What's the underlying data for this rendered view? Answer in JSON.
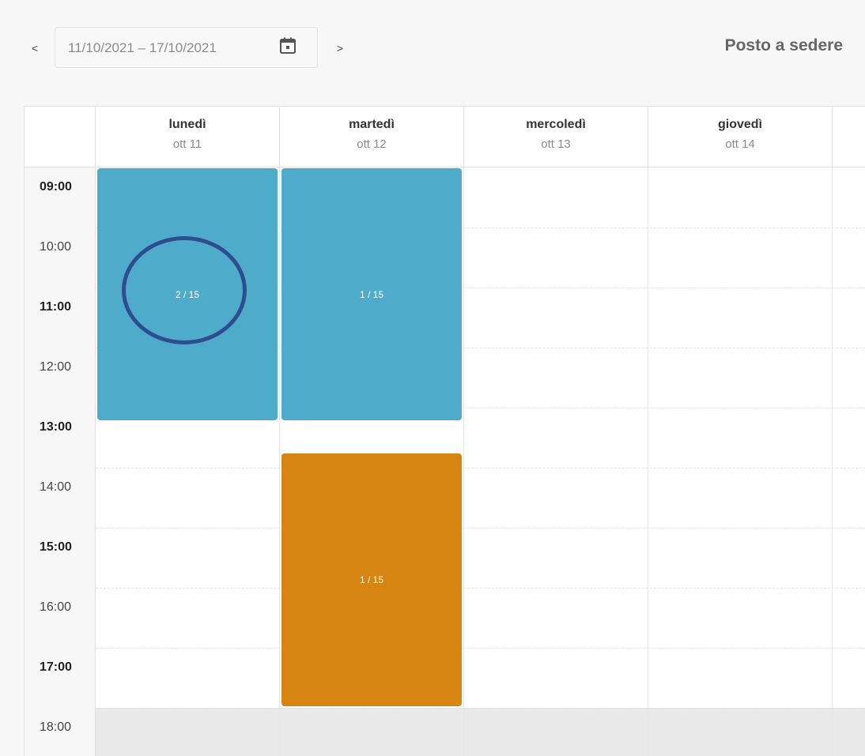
{
  "toolbar": {
    "prev_label": "<",
    "next_label": ">",
    "date_range": "11/10/2021 – 17/10/2021",
    "resource_title": "Posto a sedere",
    "calendar_icon": "calendar-icon"
  },
  "days": [
    {
      "name": "lunedì",
      "date": "ott 11"
    },
    {
      "name": "martedì",
      "date": "ott 12"
    },
    {
      "name": "mercoledì",
      "date": "ott 13"
    },
    {
      "name": "giovedì",
      "date": "ott 14"
    }
  ],
  "times": [
    {
      "label": "09:00",
      "bold": true
    },
    {
      "label": "10:00",
      "bold": false
    },
    {
      "label": "11:00",
      "bold": true
    },
    {
      "label": "12:00",
      "bold": false
    },
    {
      "label": "13:00",
      "bold": true
    },
    {
      "label": "14:00",
      "bold": false
    },
    {
      "label": "15:00",
      "bold": true
    },
    {
      "label": "16:00",
      "bold": false
    },
    {
      "label": "17:00",
      "bold": true
    },
    {
      "label": "18:00",
      "bold": false
    }
  ],
  "events": [
    {
      "day": "lunedì",
      "start": "09:00",
      "end": "13:15",
      "label": "2 / 15",
      "color": "#4fabca"
    },
    {
      "day": "martedì",
      "start": "09:00",
      "end": "13:15",
      "label": "1 / 15",
      "color": "#4fabca"
    },
    {
      "day": "martedì",
      "start": "13:45",
      "end": "18:00",
      "label": "1 / 15",
      "color": "#d68512"
    }
  ],
  "colors": {
    "accent_blue": "#4fabca",
    "accent_orange": "#d68512",
    "highlight": "#2e4d91"
  }
}
